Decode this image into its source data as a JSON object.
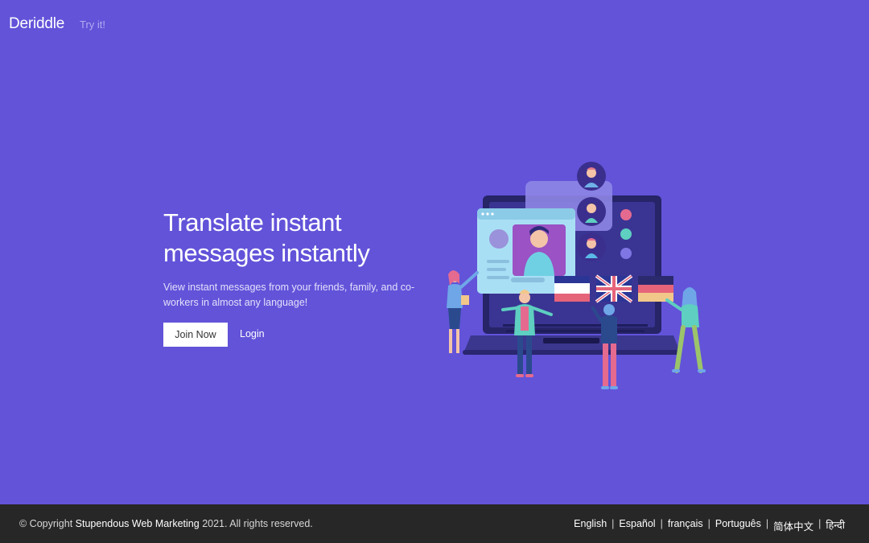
{
  "nav": {
    "brand": "Deriddle",
    "try_link": "Try it!"
  },
  "hero": {
    "headline_line1": "Translate instant",
    "headline_line2": "messages instantly",
    "description": "View instant messages from your friends, family, and co-workers in almost any language!",
    "join_button": "Join Now",
    "login_link": "Login"
  },
  "footer": {
    "copyright_prefix": "© Copyright",
    "company": "Stupendous Web Marketing",
    "copyright_suffix": "2021. All rights reserved.",
    "languages": [
      "English",
      "Español",
      "français",
      "Português",
      "简体中文",
      "हिन्दी"
    ],
    "separator": "|"
  },
  "colors": {
    "background": "#6253d9",
    "footer_bg": "#272727",
    "accent": "#ffffff"
  }
}
